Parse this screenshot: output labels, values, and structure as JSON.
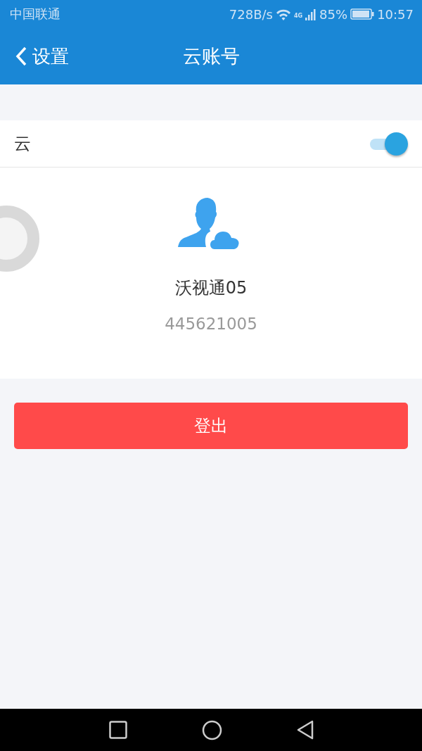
{
  "status_bar": {
    "carrier": "中国联通",
    "speed": "728B/s",
    "network": "4G",
    "battery": "85%",
    "time": "10:57"
  },
  "nav": {
    "back": "设置",
    "title": "云账号"
  },
  "cloud_toggle": {
    "label": "云",
    "on": true
  },
  "account": {
    "name": "沃视通05",
    "id": "445621005"
  },
  "logout_button": "登出"
}
